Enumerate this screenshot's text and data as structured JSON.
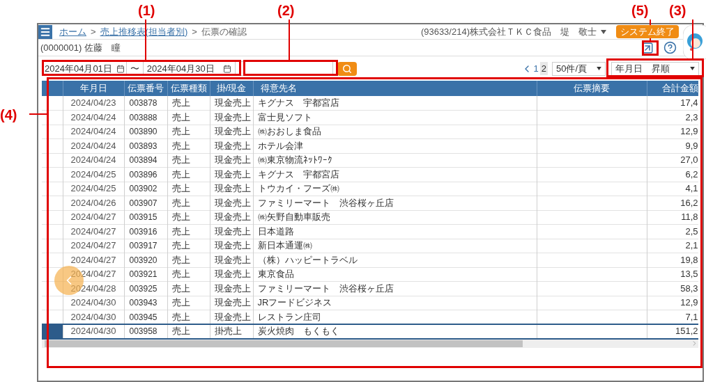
{
  "breadcrumbs": [
    {
      "kind": "link",
      "label": "ホーム"
    },
    {
      "kind": "separator",
      "label": ">"
    },
    {
      "kind": "link",
      "label": "売上推移表(担当者別)"
    },
    {
      "kind": "separator",
      "label": ">"
    },
    {
      "kind": "current",
      "label": "伝票の確認"
    }
  ],
  "user": {
    "label": "(93633/214)株式会社ＴＫＣ食品　堤　敬士"
  },
  "exit_button": "システム終了",
  "person": "(0000001) 佐藤　瞳",
  "filters": {
    "date_from": "2024年04月01日",
    "range_separator": "〜",
    "date_to": "2024年04月30日"
  },
  "pagination": {
    "pages": [
      {
        "label": "1",
        "selected": false
      },
      {
        "label": "2",
        "selected": true
      }
    ],
    "page_size": "50件/頁",
    "sort": "年月日　昇順"
  },
  "table": {
    "columns": [
      "年月日",
      "伝票番号",
      "伝票種類",
      "掛/現金",
      "得意先名",
      "伝票摘要",
      "合計金額"
    ],
    "rows": [
      {
        "date": "2024/04/23",
        "number": "003878",
        "type": "売上",
        "payment": "現金売上",
        "customer": "キグナス　宇都宮店",
        "amount": "17,4",
        "selected": false
      },
      {
        "date": "2024/04/24",
        "number": "003888",
        "type": "売上",
        "payment": "現金売上",
        "customer": "富士見ソフト",
        "amount": "2,3",
        "selected": false
      },
      {
        "date": "2024/04/24",
        "number": "003890",
        "type": "売上",
        "payment": "現金売上",
        "customer": "㈱おおしま食品",
        "amount": "12,9",
        "selected": false
      },
      {
        "date": "2024/04/24",
        "number": "003893",
        "type": "売上",
        "payment": "現金売上",
        "customer": "ホテル会津",
        "amount": "9,9",
        "selected": false
      },
      {
        "date": "2024/04/24",
        "number": "003894",
        "type": "売上",
        "payment": "現金売上",
        "customer": "㈱東京物流ﾈｯﾄﾜｰｸ",
        "amount": "27,0",
        "selected": false
      },
      {
        "date": "2024/04/25",
        "number": "003896",
        "type": "売上",
        "payment": "現金売上",
        "customer": "キグナス　宇都宮店",
        "amount": "6,2",
        "selected": false
      },
      {
        "date": "2024/04/25",
        "number": "003902",
        "type": "売上",
        "payment": "現金売上",
        "customer": "トウカイ・フーズ㈱",
        "amount": "4,1",
        "selected": false
      },
      {
        "date": "2024/04/26",
        "number": "003907",
        "type": "売上",
        "payment": "現金売上",
        "customer": "ファミリーマート　渋谷桜ヶ丘店",
        "amount": "16,2",
        "selected": false
      },
      {
        "date": "2024/04/27",
        "number": "003915",
        "type": "売上",
        "payment": "現金売上",
        "customer": "㈱矢野自動車販売",
        "amount": "11,8",
        "selected": false
      },
      {
        "date": "2024/04/27",
        "number": "003916",
        "type": "売上",
        "payment": "現金売上",
        "customer": "日本道路",
        "amount": "2,5",
        "selected": false
      },
      {
        "date": "2024/04/27",
        "number": "003917",
        "type": "売上",
        "payment": "現金売上",
        "customer": "新日本通運㈱",
        "amount": "2,1",
        "selected": false
      },
      {
        "date": "2024/04/27",
        "number": "003920",
        "type": "売上",
        "payment": "現金売上",
        "customer": "（株）ハッピートラベル",
        "amount": "19,8",
        "selected": false
      },
      {
        "date": "2024/04/27",
        "number": "003921",
        "type": "売上",
        "payment": "現金売上",
        "customer": "東京食品",
        "amount": "13,5",
        "selected": false
      },
      {
        "date": "2024/04/28",
        "number": "003925",
        "type": "売上",
        "payment": "現金売上",
        "customer": "ファミリーマート　渋谷桜ヶ丘店",
        "amount": "58,3",
        "selected": false
      },
      {
        "date": "2024/04/30",
        "number": "003943",
        "type": "売上",
        "payment": "現金売上",
        "customer": "JRフードビジネス",
        "amount": "12,9",
        "selected": false
      },
      {
        "date": "2024/04/30",
        "number": "003945",
        "type": "売上",
        "payment": "現金売上",
        "customer": "レストラン庄司",
        "amount": "7,1",
        "selected": false
      },
      {
        "date": "2024/04/30",
        "number": "003958",
        "type": "売上",
        "payment": "掛売上",
        "customer": "炭火焼肉　もくもく",
        "amount": "151,2",
        "selected": true
      }
    ]
  },
  "annotations": [
    {
      "label": "(1)"
    },
    {
      "label": "(2)"
    },
    {
      "label": "(5)"
    },
    {
      "label": "(3)"
    },
    {
      "label": "(4)"
    }
  ]
}
